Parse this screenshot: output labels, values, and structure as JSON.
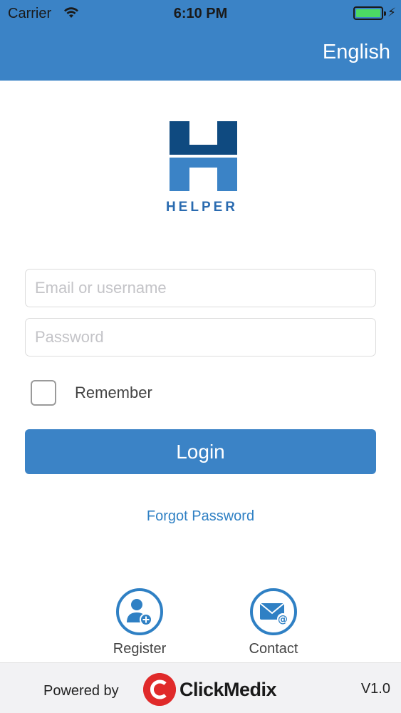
{
  "status_bar": {
    "carrier": "Carrier",
    "time": "6:10 PM"
  },
  "header": {
    "language": "English",
    "color": "#3b83c6"
  },
  "logo": {
    "text": "HELPER",
    "colors": {
      "dark": "#0f4a80",
      "light": "#3b83c6"
    }
  },
  "form": {
    "email_placeholder": "Email or username",
    "password_placeholder": "Password",
    "remember_label": "Remember",
    "remember_checked": false,
    "login_label": "Login",
    "forgot_label": "Forgot Password"
  },
  "actions": {
    "register_label": "Register",
    "register_icon": "add-user-icon",
    "contact_label": "Contact",
    "contact_icon": "email-at-icon"
  },
  "footer": {
    "powered_by": "Powered by",
    "brand": "ClickMedix",
    "version": "V1.0"
  }
}
